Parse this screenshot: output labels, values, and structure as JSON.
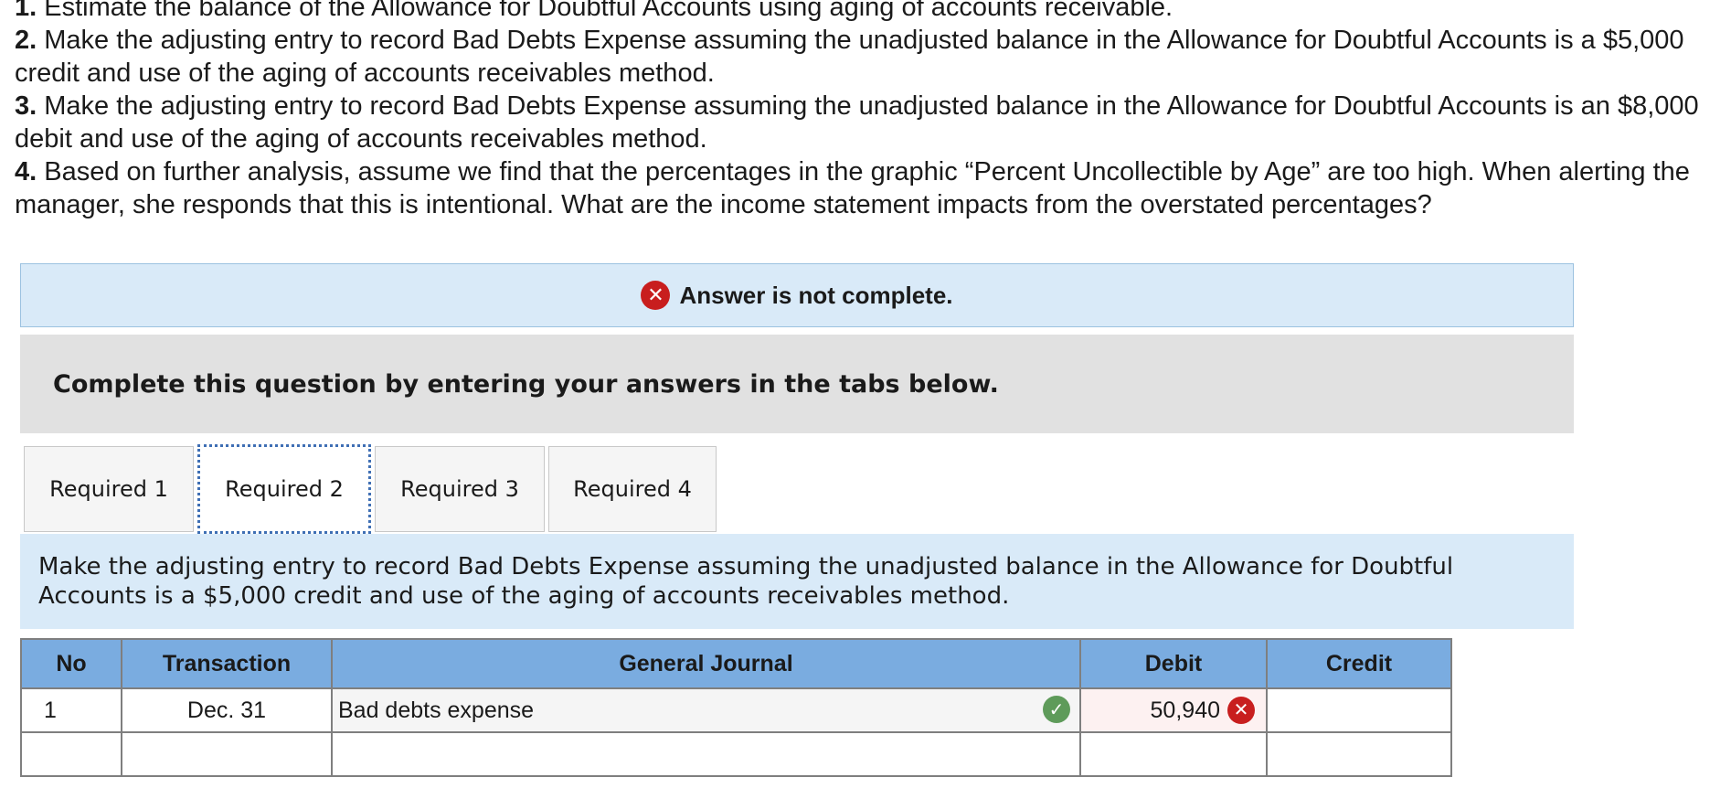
{
  "questions": [
    {
      "num": "1.",
      "text": " Estimate the balance of the Allowance for Doubtful Accounts using aging of accounts receivable."
    },
    {
      "num": "2.",
      "text": " Make the adjusting entry to record Bad Debts Expense assuming the unadjusted balance in the Allowance for Doubtful Accounts is a $5,000 credit and use of the aging of accounts receivables method."
    },
    {
      "num": "3.",
      "text": " Make the adjusting entry to record Bad Debts Expense assuming the unadjusted balance in the Allowance for Doubtful Accounts is an $8,000 debit and use of the aging of accounts receivables method."
    },
    {
      "num": "4.",
      "text": " Based on further analysis, assume we find that the percentages in the graphic “Percent Uncollectible by Age” are too high. When alerting the manager, she responds that this is intentional. What are the income statement impacts from the overstated percentages?"
    }
  ],
  "banner": {
    "text": "Answer is not complete.",
    "icon": "x-circle-icon"
  },
  "instruction": "Complete this question by entering your answers in the tabs below.",
  "tabs": [
    {
      "label": "Required 1",
      "active": false
    },
    {
      "label": "Required 2",
      "active": true
    },
    {
      "label": "Required 3",
      "active": false
    },
    {
      "label": "Required 4",
      "active": false
    }
  ],
  "required_text": "Make the adjusting entry to record Bad Debts Expense assuming the unadjusted balance in the Allowance for Doubtful Accounts is a $5,000 credit and use of the aging of accounts receivables method.",
  "journal": {
    "headers": {
      "no": "No",
      "transaction": "Transaction",
      "general_journal": "General Journal",
      "debit": "Debit",
      "credit": "Credit"
    },
    "rows": [
      {
        "no": "1",
        "transaction": "Dec. 31",
        "account": "Bad debts expense",
        "account_status": "correct",
        "debit": "50,940",
        "debit_status": "incorrect",
        "credit": ""
      },
      {
        "no": "",
        "transaction": "",
        "account": "",
        "debit": "",
        "credit": ""
      }
    ]
  },
  "colors": {
    "header_blue": "#7aace0",
    "panel_blue": "#d9eaf8",
    "error_red": "#c81e1e",
    "check_green": "#5e9b5a"
  }
}
